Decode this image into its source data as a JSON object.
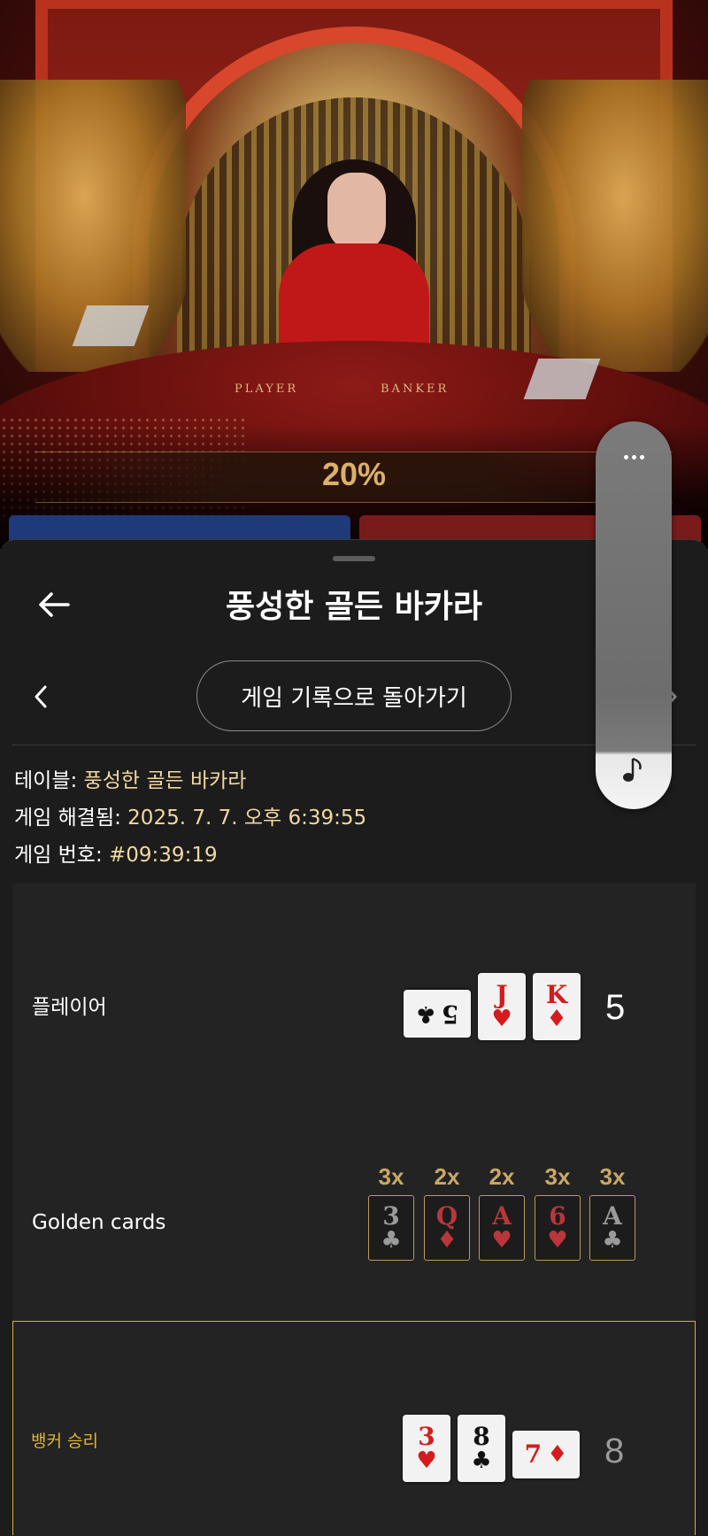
{
  "video": {
    "table_player_label": "PLAYER",
    "table_banker_label": "BANKER",
    "percent": "20%"
  },
  "sheet": {
    "title": "풍성한 골든 바카라",
    "back_to_history": "게임 기록으로 돌아가기"
  },
  "info": {
    "table_label": "테이블: ",
    "table_value": "풍성한 골든 바카라",
    "resolved_label": "게임 해결됨: ",
    "resolved_value": "2025. 7. 7. 오후 6:39:55",
    "number_label": "게임 번호: ",
    "number_value": "#09:39:19"
  },
  "round": {
    "player": {
      "label": "플레이어",
      "score": "5",
      "cards": [
        {
          "rank": "5",
          "suit": "♣",
          "color": "black",
          "sideways": true
        },
        {
          "rank": "J",
          "suit": "♥",
          "color": "red"
        },
        {
          "rank": "K",
          "suit": "♦",
          "color": "red"
        }
      ]
    },
    "golden": {
      "label": "Golden cards",
      "cards": [
        {
          "mult": "3x",
          "rank": "3",
          "suit": "♣",
          "color": "dark"
        },
        {
          "mult": "2x",
          "rank": "Q",
          "suit": "♦",
          "color": "red"
        },
        {
          "mult": "2x",
          "rank": "A",
          "suit": "♥",
          "color": "red"
        },
        {
          "mult": "3x",
          "rank": "6",
          "suit": "♥",
          "color": "red"
        },
        {
          "mult": "3x",
          "rank": "A",
          "suit": "♣",
          "color": "dark"
        }
      ]
    },
    "banker": {
      "label": "뱅커 승리",
      "score": "8",
      "cards": [
        {
          "rank": "3",
          "suit": "♥",
          "color": "red"
        },
        {
          "rank": "8",
          "suit": "♣",
          "color": "black"
        },
        {
          "rank": "7",
          "suit": "♦",
          "color": "red",
          "sideways": true
        }
      ]
    }
  },
  "colors": {
    "accent_gold": "#d8b030",
    "value_text": "#f2d8a0",
    "sheet_bg": "#1c1c1c"
  },
  "icons": {
    "back": "arrow-left-icon",
    "prev": "chevron-left-icon",
    "next": "chevron-right-icon",
    "more": "more-horizontal-icon",
    "music": "music-note-icon"
  }
}
